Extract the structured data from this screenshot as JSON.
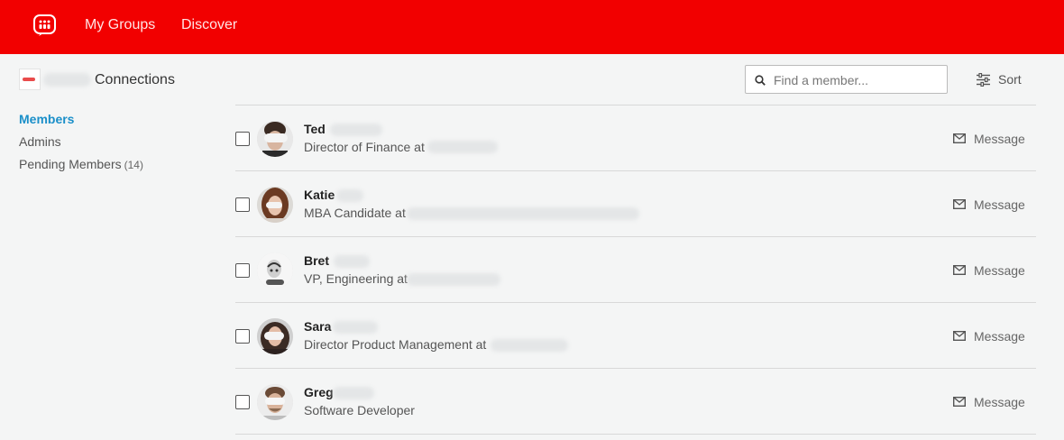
{
  "app": {
    "logo_icon": "meetup-chat-logo-icon",
    "brand_color": "#f20000"
  },
  "nav": {
    "my_groups": "My Groups",
    "discover": "Discover"
  },
  "group": {
    "title_suffix": "Connections"
  },
  "search": {
    "placeholder": "Find a member..."
  },
  "sort": {
    "label": "Sort",
    "icon": "sliders-icon"
  },
  "sidebar": {
    "items": [
      {
        "label": "Members",
        "active": true
      },
      {
        "label": "Admins",
        "active": false
      },
      {
        "label": "Pending Members",
        "count": "(14)",
        "active": false
      }
    ],
    "active_color": "#1a8fc9"
  },
  "members": [
    {
      "name": "Ted",
      "headline": "Director of Finance at",
      "message_label": "Message"
    },
    {
      "name": "Katie",
      "headline": "MBA Candidate at",
      "message_label": "Message"
    },
    {
      "name": "Bret",
      "headline": "VP, Engineering at",
      "message_label": "Message"
    },
    {
      "name": "Sara",
      "headline": "Director Product Management at",
      "message_label": "Message"
    },
    {
      "name": "Greg",
      "headline": "Software Developer",
      "message_label": "Message"
    }
  ]
}
